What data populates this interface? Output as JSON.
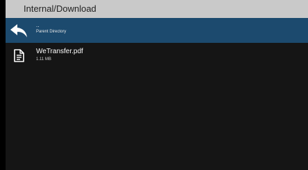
{
  "window": {
    "title": "Internal/Download"
  },
  "parent_row": {
    "label": "..",
    "sublabel": "Parent Directory",
    "icon": "back-arrow-icon"
  },
  "files": [
    {
      "name": "WeTransfer.pdf",
      "size": "1.11 MB",
      "icon": "document-icon"
    }
  ],
  "colors": {
    "titlebar": "#c9c9c9",
    "selected_row": "#1c4a6e",
    "background": "#151515"
  }
}
